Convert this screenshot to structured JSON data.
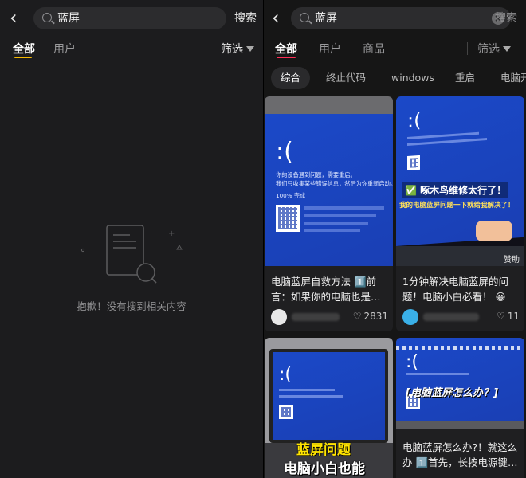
{
  "left": {
    "query": "蓝屏",
    "search_button": "搜索",
    "tabs": [
      "全部",
      "用户"
    ],
    "filter_label": "筛选",
    "empty_message": "抱歉！没有搜到相关内容"
  },
  "right": {
    "query": "蓝屏",
    "search_button": "搜索",
    "tabs": [
      "全部",
      "用户",
      "商品"
    ],
    "filter_label": "筛选",
    "chips": [
      "综合",
      "终止代码",
      "windows",
      "重启",
      "电脑开"
    ],
    "cards": [
      {
        "title": "电脑蓝屏自救方法 1️⃣前言：如果你的电脑也是…",
        "likes": "2831",
        "bsod_lines": [
          "你的设备遇到问题，需要重启。",
          "我们只收集某些错误信息，然后为你重新启动。",
          "100% 完成"
        ]
      },
      {
        "title": "1分钟解决电脑蓝屏的问题！电脑小白必看！ 😀",
        "likes": "11",
        "overlay_line1": "✅ 啄木鸟维修太行了！",
        "overlay_line2": "我的电脑蓝屏问题一下就给我解决了！",
        "badge": "赞助"
      },
      {
        "overlay_line1": "蓝屏问题",
        "overlay_line2": "电脑小白也能"
      },
      {
        "title": "电脑蓝屏怎么办?！就这么办 1️⃣首先，长按电源键…",
        "overlay_line1": "[电脑蓝屏怎么办？]"
      }
    ]
  },
  "colors": {
    "accent_left": "#f5b800",
    "accent_right": "#ff2d55",
    "bsod_blue": "#1b49c8"
  }
}
